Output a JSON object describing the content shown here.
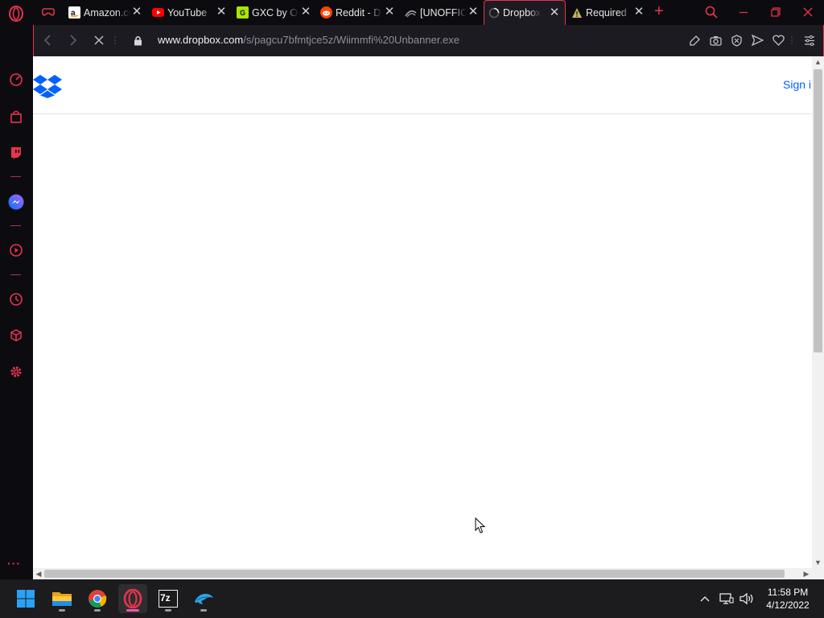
{
  "browser": {
    "tabs": [
      {
        "title": "Amazon.co",
        "favicon": "amazon-icon",
        "color": "#ffffff",
        "active": false
      },
      {
        "title": "YouTube",
        "favicon": "youtube-icon",
        "color": "#ff0000",
        "active": false
      },
      {
        "title": "GXC by O",
        "favicon": "gxc-icon",
        "color": "#a8e600",
        "active": false
      },
      {
        "title": "Reddit - D",
        "favicon": "reddit-icon",
        "color": "#ff4500",
        "active": false
      },
      {
        "title": "[UNOFFIC",
        "favicon": "mod-icon",
        "color": "#9a9a9a",
        "active": false
      },
      {
        "title": "Dropbox",
        "favicon": "loading-spinner-icon",
        "color": "#cccccc",
        "active": true
      },
      {
        "title": "Required",
        "favicon": "warning-icon",
        "color": "#c8b45a",
        "active": false
      }
    ],
    "address": {
      "host": "www.dropbox.com",
      "path": "/s/pagcu7bfmtjce5z/Wiimmfi%20Unbanner.exe"
    },
    "accent_color": "#e8344b"
  },
  "page": {
    "signin_label": "Sign i"
  },
  "taskbar": {
    "apps": [
      "start-icon",
      "file-explorer-icon",
      "chrome-icon",
      "opera-icon",
      "7zip-icon",
      "dolphin-icon"
    ],
    "sevenzip_label": "7z",
    "clock": {
      "time": "11:58 PM",
      "date": "4/12/2022"
    }
  }
}
